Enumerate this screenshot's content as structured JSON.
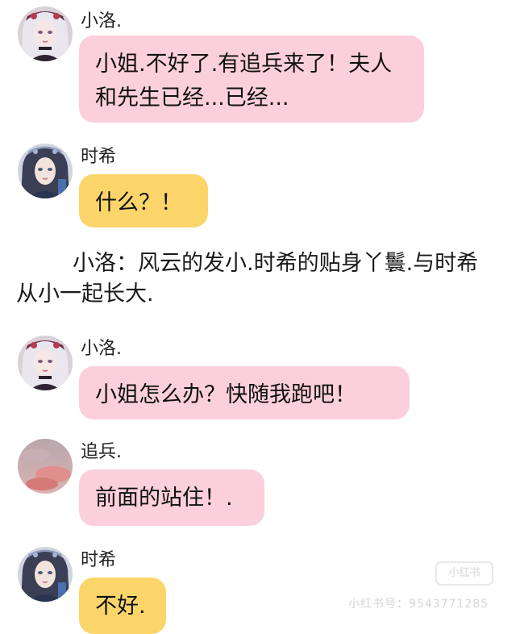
{
  "messages": [
    {
      "name": "小洛.",
      "text": "小姐.不好了.有追兵来了！夫人和先生已经...已经...",
      "avatar": "silver-hair-girl-avatar"
    },
    {
      "name": "时希",
      "text": "什么？！",
      "avatar": "dark-hair-girl-avatar"
    },
    {
      "name": "小洛.",
      "text": "小姐怎么办？快随我跑吧！",
      "avatar": "silver-hair-girl-avatar"
    },
    {
      "name": "追兵.",
      "text": "前面的站住！.",
      "avatar": "sunset-cloud-avatar"
    },
    {
      "name": "时希",
      "text": "不好.",
      "avatar": "dark-hair-girl-avatar"
    }
  ],
  "narration": "小洛：风云的发小.时希的贴身丫鬟.与时希从小一起长大.",
  "watermark": {
    "logo": "小红书",
    "text": "小红书号：9543771285"
  },
  "colors": {
    "pink_bubble": "#fbd0dc",
    "yellow_bubble": "#fcd56a"
  }
}
